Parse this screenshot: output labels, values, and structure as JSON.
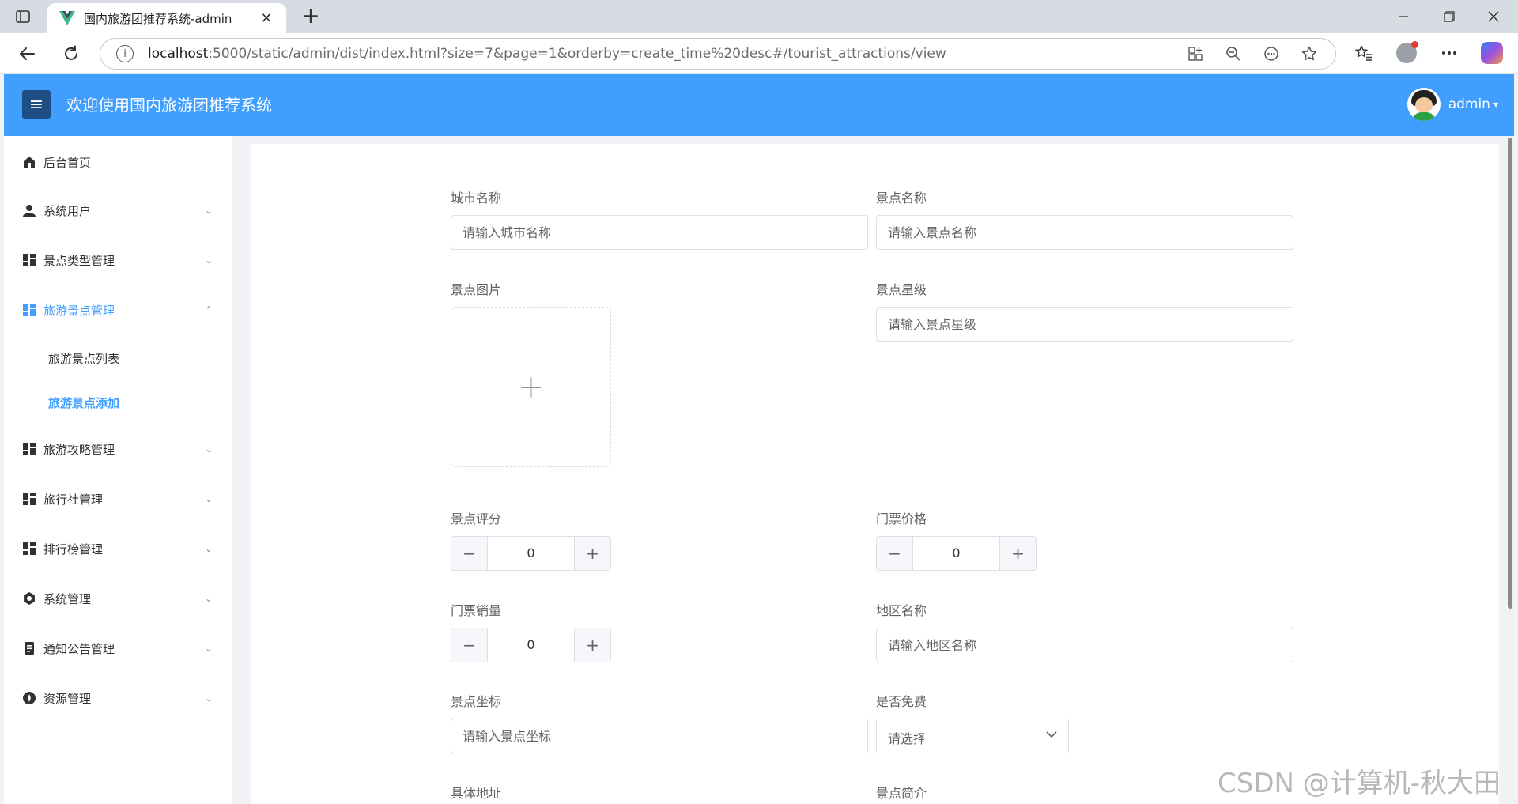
{
  "browser": {
    "tab_title": "国内旅游团推荐系统-admin",
    "url_host": "localhost",
    "url_rest": ":5000/static/admin/dist/index.html?size=7&page=1&orderby=create_time%20desc#/tourist_attractions/view",
    "new_tab_symbol": "+",
    "close_symbol": "✕"
  },
  "header": {
    "menu_icon": "≡",
    "title": "欢迎使用国内旅游团推荐系统",
    "user_name": "admin",
    "user_caret": "▾"
  },
  "sidebar": {
    "items": [
      {
        "label": "后台首页",
        "icon": "home-icon"
      },
      {
        "label": "系统用户",
        "icon": "user-icon"
      },
      {
        "label": "景点类型管理",
        "icon": "grid-icon"
      },
      {
        "label": "旅游景点管理",
        "icon": "grid-icon"
      },
      {
        "label": "旅游攻略管理",
        "icon": "grid-icon"
      },
      {
        "label": "旅行社管理",
        "icon": "grid-icon"
      },
      {
        "label": "排行榜管理",
        "icon": "grid-icon"
      },
      {
        "label": "系统管理",
        "icon": "gear-icon"
      },
      {
        "label": "通知公告管理",
        "icon": "document-icon"
      },
      {
        "label": "资源管理",
        "icon": "compass-icon"
      }
    ],
    "submenu": [
      {
        "label": "旅游景点列表"
      },
      {
        "label": "旅游景点添加"
      }
    ],
    "caret_down": "⌄",
    "caret_up": "⌃",
    "active_color": "#409eff"
  },
  "form": {
    "city_name": {
      "label": "城市名称",
      "placeholder": "请输入城市名称"
    },
    "attraction_name": {
      "label": "景点名称",
      "placeholder": "请输入景点名称"
    },
    "attraction_image": {
      "label": "景点图片",
      "plus": "+"
    },
    "star_level": {
      "label": "景点星级",
      "placeholder": "请输入景点星级"
    },
    "rating": {
      "label": "景点评分",
      "value": "0",
      "minus": "−",
      "plus": "+"
    },
    "ticket_price": {
      "label": "门票价格",
      "value": "0",
      "minus": "−",
      "plus": "+"
    },
    "ticket_sales": {
      "label": "门票销量",
      "value": "0",
      "minus": "−",
      "plus": "+"
    },
    "region_name": {
      "label": "地区名称",
      "placeholder": "请输入地区名称"
    },
    "coordinates": {
      "label": "景点坐标",
      "placeholder": "请输入景点坐标"
    },
    "is_free": {
      "label": "是否免费",
      "selected": "请选择"
    },
    "address": {
      "label": "具体地址"
    },
    "intro": {
      "label": "景点简介"
    }
  },
  "watermark": "CSDN @计算机-秋大田",
  "colors": {
    "header_bg": "#409eff",
    "accent": "#409eff"
  }
}
